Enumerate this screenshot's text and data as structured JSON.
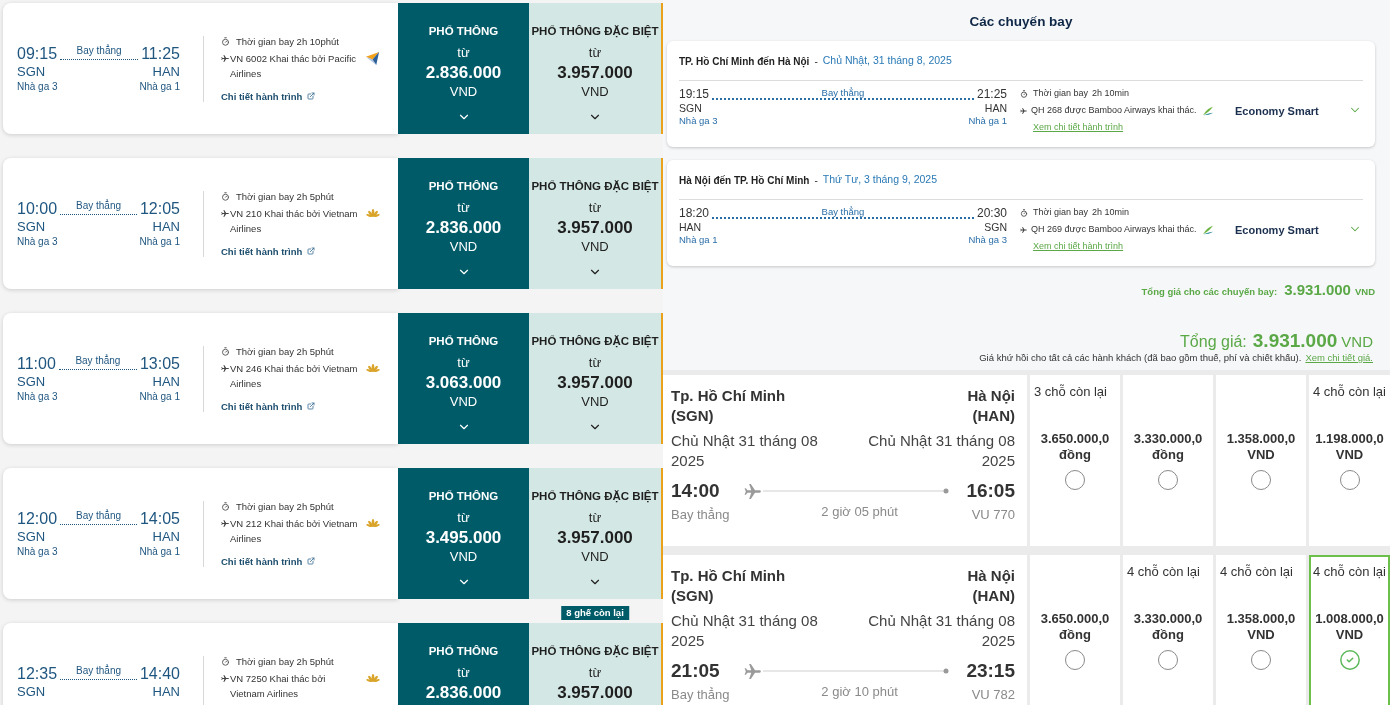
{
  "flight_list": {
    "flights": [
      {
        "depart_time": "09:15",
        "depart_airport": "SGN",
        "depart_terminal": "Nhà ga 3",
        "stops": "Bay thẳng",
        "arrive_time": "11:25",
        "arrive_airport": "HAN",
        "arrive_terminal": "Nhà ga 1",
        "duration": "Thời gian bay 2h 10phút",
        "flight_info": "VN 6002 Khai thác bởi Pacific Airlines",
        "kind": "pacific",
        "details_link": "Chi tiết hành trình",
        "fares": [
          {
            "kind": "economy",
            "cabin": "PHỔ THÔNG",
            "from": "từ",
            "price": "2.836.000",
            "currency": "VND"
          },
          {
            "kind": "premium",
            "cabin": "PHỔ THÔNG ĐẶC BIỆT",
            "from": "từ",
            "price": "3.957.000",
            "currency": "VND"
          }
        ]
      },
      {
        "depart_time": "10:00",
        "depart_airport": "SGN",
        "depart_terminal": "Nhà ga 3",
        "stops": "Bay thẳng",
        "arrive_time": "12:05",
        "arrive_airport": "HAN",
        "arrive_terminal": "Nhà ga 1",
        "duration": "Thời gian bay 2h 5phút",
        "flight_info": "VN 210 Khai thác bởi Vietnam Airlines",
        "kind": "vietnam",
        "details_link": "Chi tiết hành trình",
        "fares": [
          {
            "kind": "economy",
            "cabin": "PHỔ THÔNG",
            "from": "từ",
            "price": "2.836.000",
            "currency": "VND"
          },
          {
            "kind": "premium",
            "cabin": "PHỔ THÔNG ĐẶC BIỆT",
            "from": "từ",
            "price": "3.957.000",
            "currency": "VND"
          }
        ]
      },
      {
        "depart_time": "11:00",
        "depart_airport": "SGN",
        "depart_terminal": "Nhà ga 3",
        "stops": "Bay thẳng",
        "arrive_time": "13:05",
        "arrive_airport": "HAN",
        "arrive_terminal": "Nhà ga 1",
        "duration": "Thời gian bay 2h 5phút",
        "flight_info": "VN 246 Khai thác bởi Vietnam Airlines",
        "kind": "vietnam",
        "details_link": "Chi tiết hành trình",
        "fares": [
          {
            "kind": "economy",
            "cabin": "PHỔ THÔNG",
            "from": "từ",
            "price": "3.063.000",
            "currency": "VND"
          },
          {
            "kind": "premium",
            "cabin": "PHỔ THÔNG ĐẶC BIỆT",
            "from": "từ",
            "price": "3.957.000",
            "currency": "VND"
          }
        ]
      },
      {
        "depart_time": "12:00",
        "depart_airport": "SGN",
        "depart_terminal": "Nhà ga 3",
        "stops": "Bay thẳng",
        "arrive_time": "14:05",
        "arrive_airport": "HAN",
        "arrive_terminal": "Nhà ga 1",
        "duration": "Thời gian bay 2h 5phút",
        "flight_info": "VN 212 Khai thác bởi Vietnam Airlines",
        "kind": "vietnam",
        "details_link": "Chi tiết hành trình",
        "fares": [
          {
            "kind": "economy",
            "cabin": "PHỔ THÔNG",
            "from": "từ",
            "price": "3.495.000",
            "currency": "VND"
          },
          {
            "kind": "premium",
            "cabin": "PHỔ THÔNG ĐẶC BIỆT",
            "from": "từ",
            "price": "3.957.000",
            "currency": "VND"
          }
        ]
      },
      {
        "depart_time": "12:35",
        "depart_airport": "SGN",
        "stops": "Bay thẳng",
        "arrive_time": "14:40",
        "arrive_airport": "HAN",
        "duration": "Thời gian bay 2h 5phút",
        "flight_info": "VN 7250 Khai thác bởi Vietnam Airlines",
        "kind": "vietnam",
        "fares": [
          {
            "kind": "economy",
            "cabin": "PHỔ THÔNG",
            "from": "từ",
            "price": "2.836.000"
          },
          {
            "kind": "premium",
            "cabin": "PHỔ THÔNG ĐẶC BIỆT",
            "from": "từ",
            "price": "3.957.000",
            "badge": "8 ghế còn lại"
          }
        ]
      }
    ]
  },
  "summary": {
    "title": "Các chuyến bay",
    "legs": [
      {
        "route": "TP. Hồ Chí Minh đến Hà Nội",
        "separator": "-",
        "date": "Chủ Nhật, 31 tháng 8, 2025",
        "depart_time": "19:15",
        "depart_airport": "SGN",
        "depart_terminal": "Nhà ga 3",
        "stops": "Bay thẳng",
        "arrive_time": "21:25",
        "arrive_airport": "HAN",
        "arrive_terminal": "Nhà ga 1",
        "duration_label": "Thời gian bay",
        "duration": "2h 10min",
        "flight_info": "QH 268 được Bamboo Airways khai thác.",
        "kind": "bamboo",
        "details_link": "Xem chi tiết hành trình",
        "fare_class": "Economy Smart"
      },
      {
        "route": "Hà Nội đến TP. Hồ Chí Minh",
        "separator": "-",
        "date": "Thứ Tư, 3 tháng 9, 2025",
        "depart_time": "18:20",
        "depart_airport": "HAN",
        "depart_terminal": "Nhà ga 1",
        "stops": "Bay thẳng",
        "arrive_time": "20:30",
        "arrive_airport": "SGN",
        "arrive_terminal": "Nhà ga 3",
        "duration_label": "Thời gian bay",
        "duration": "2h 10min",
        "flight_info": "QH 269 được Bamboo Airways khai thác.",
        "kind": "bamboo",
        "details_link": "Xem chi tiết hành trình",
        "fare_class": "Economy Smart"
      }
    ],
    "subtotal_label": "Tổng giá cho các chuyến bay:",
    "subtotal": "3.931.000",
    "subtotal_currency": "VND",
    "total_label": "Tổng giá:",
    "total": "3.931.000",
    "total_currency": "VND",
    "note": "Giá khứ hồi cho tất cả các hành khách (đã bao gồm thuế, phí và chiết khấu).",
    "note_link": "Xem chi tiết giá."
  },
  "fare_table": {
    "rows": [
      {
        "origin_city": "Tp. Hồ Chí Minh",
        "origin_code": "(SGN)",
        "destination_city": "Hà Nội",
        "destination_code": "(HAN)",
        "depart_date": "Chủ Nhật 31 tháng 08 2025",
        "arrive_date": "Chủ Nhật 31 tháng 08 2025",
        "depart_time": "14:00",
        "arrive_time": "16:05",
        "stops": "Bay thẳng",
        "duration": "2 giờ 05 phút",
        "flight_number": "VU 770",
        "fares": [
          {
            "seats_left": "3 chỗ còn lại",
            "price": "3.650.000,0",
            "currency": "đồng",
            "selected": false
          },
          {
            "price": "3.330.000,0",
            "currency": "đồng",
            "selected": false
          },
          {
            "price": "1.358.000,0",
            "currency": "VND",
            "selected": false
          },
          {
            "seats_left": "4 chỗ còn lại",
            "price": "1.198.000,0",
            "currency": "VND",
            "selected": false
          }
        ]
      },
      {
        "origin_city": "Tp. Hồ Chí Minh",
        "origin_code": "(SGN)",
        "destination_city": "Hà Nội",
        "destination_code": "(HAN)",
        "depart_date": "Chủ Nhật 31 tháng 08 2025",
        "arrive_date": "Chủ Nhật 31 tháng 08 2025",
        "depart_time": "21:05",
        "arrive_time": "23:15",
        "stops": "Bay thẳng",
        "duration": "2 giờ 10 phút",
        "flight_number": "VU 782",
        "fares": [
          {
            "price": "3.650.000,0",
            "currency": "đồng",
            "selected": false
          },
          {
            "seats_left": "4 chỗ còn lại",
            "price": "3.330.000,0",
            "currency": "đồng",
            "selected": false
          },
          {
            "seats_left": "4 chỗ còn lại",
            "price": "1.358.000,0",
            "currency": "VND",
            "selected": false
          },
          {
            "seats_left": "4 chỗ còn lại",
            "price": "1.008.000,0",
            "currency": "VND",
            "selected": true
          }
        ]
      }
    ]
  }
}
